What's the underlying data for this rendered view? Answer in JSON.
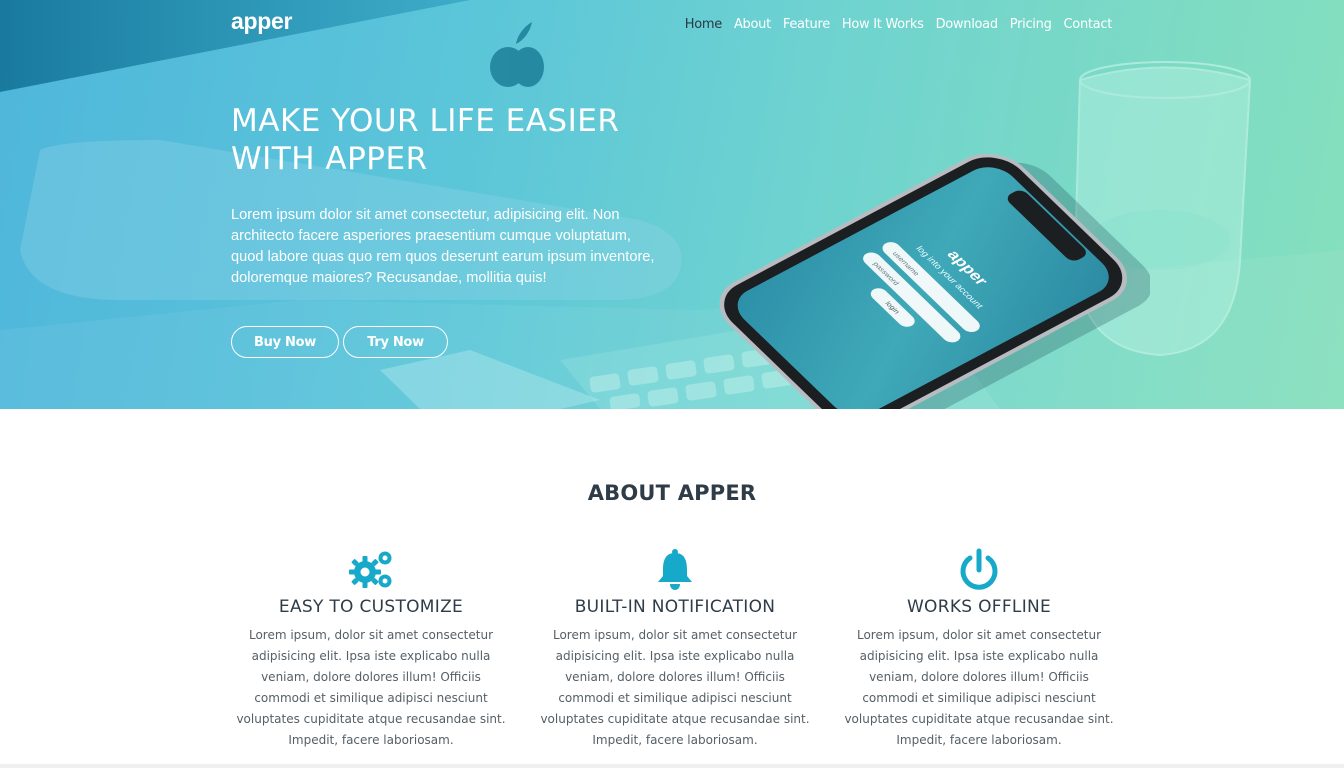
{
  "brand": {
    "logo": "apper"
  },
  "nav": {
    "items": [
      {
        "label": "Home",
        "active": true
      },
      {
        "label": "About"
      },
      {
        "label": "Feature"
      },
      {
        "label": "How It Works"
      },
      {
        "label": "Download"
      },
      {
        "label": "Pricing"
      },
      {
        "label": "Contact"
      }
    ]
  },
  "hero": {
    "title_line1": "MAKE YOUR LIFE EASIER",
    "title_line2": "WITH APPER",
    "text": "Lorem ipsum dolor sit amet consectetur, adipisicing elit. Non architecto facere asperiores praesentium cumque voluptatum, quod labore quas quo rem quos deserunt earum ipsum inventore, doloremque maiores? Recusandae, mollitia quis!",
    "buy_label": "Buy Now",
    "try_label": "Try Now",
    "phone_screen": {
      "logo": "apper",
      "subtitle": "log into your account",
      "username_placeholder": "username",
      "password_placeholder": "password",
      "login_label": "login"
    }
  },
  "about": {
    "title": "ABOUT APPER",
    "features": [
      {
        "icon": "gears-icon",
        "title": "EASY TO CUSTOMIZE",
        "text": "Lorem ipsum, dolor sit amet consectetur adipisicing elit. Ipsa iste explicabo nulla veniam, dolore dolores illum! Officiis commodi et similique adipisci nesciunt voluptates cupiditate atque recusandae sint. Impedit, facere laboriosam."
      },
      {
        "icon": "bell-icon",
        "title": "BUILT-IN NOTIFICATION",
        "text": "Lorem ipsum, dolor sit amet consectetur adipisicing elit. Ipsa iste explicabo nulla veniam, dolore dolores illum! Officiis commodi et similique adipisci nesciunt voluptates cupiditate atque recusandae sint. Impedit, facere laboriosam."
      },
      {
        "icon": "power-icon",
        "title": "WORKS OFFLINE",
        "text": "Lorem ipsum, dolor sit amet consectetur adipisicing elit. Ipsa iste explicabo nulla veniam, dolore dolores illum! Officiis commodi et similique adipisci nesciunt voluptates cupiditate atque recusandae sint. Impedit, facere laboriosam."
      }
    ]
  },
  "colors": {
    "accent": "#17a9c9",
    "heading": "#2f3c48",
    "hero_gradient_start": "#4fb6db",
    "hero_gradient_end": "#86e0bd"
  }
}
